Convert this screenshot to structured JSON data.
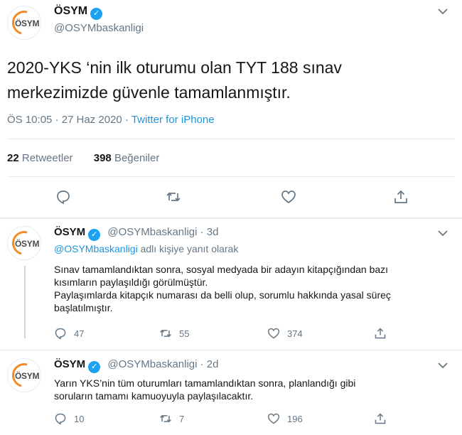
{
  "main_tweet": {
    "avatar_text": "ÖSYM",
    "name": "ÖSYM",
    "handle": "@OSYMbaskanligi",
    "text_line1": "2020-YKS ‘nin ilk oturumu olan TYT 188 sınav",
    "text_line2": "merkezimizde güvenle tamamlanmıştır.",
    "time": "ÖS 10:05 · 27 Haz 2020 · ",
    "source": "Twitter for iPhone",
    "retweets_count": "22",
    "retweets_label": "Retweetler",
    "likes_count": "398",
    "likes_label": "Beğeniler",
    "actions": [
      "reply-icon",
      "retweet-icon",
      "like-icon",
      "share-icon"
    ]
  },
  "replies": [
    {
      "avatar_text": "ÖSYM",
      "name": "ÖSYM",
      "handle_time": "@OSYMbaskanligi · 3d",
      "reply_to_link": "@OSYMbaskanligi",
      "reply_to_text": " adlı kişiye yanıt olarak",
      "lines": [
        "Sınav tamamlandıktan sonra, sosyal medyada bir adayın kitapçığından bazı",
        "kısımların paylaşıldığı görülmüştür.",
        "Paylaşımlarda kitapçık numarası da belli olup, sorumlu hakkında yasal süreç",
        "başlatılmıştır."
      ],
      "replies_count": "47",
      "retweets_count": "55",
      "likes_count": "374"
    },
    {
      "avatar_text": "ÖSYM",
      "name": "ÖSYM",
      "handle_time": "@OSYMbaskanligi · 2d",
      "lines": [
        "Yarın YKS’nin tüm oturumları tamamlandıktan sonra, planlandığı gibi",
        "soruların tamamı kamuoyuyla paylaşılacaktır."
      ],
      "replies_count": "10",
      "retweets_count": "7",
      "likes_count": "196"
    }
  ],
  "colors": {
    "accent": "#1da1f2",
    "link": "#1b95e0",
    "muted": "#657786",
    "logo_orange": "#f28c28"
  }
}
